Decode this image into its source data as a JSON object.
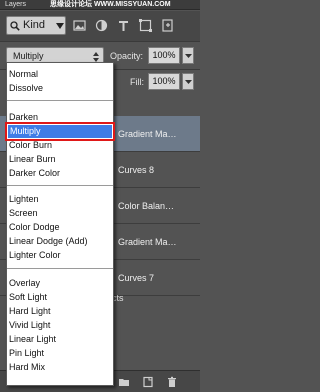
{
  "panel": {
    "title": "Layers",
    "watermark": "思缘设计论坛 WWW.MISSYUAN.COM"
  },
  "filter": {
    "kind_label": "Kind",
    "icons": [
      "image-filter-icon",
      "adjustment-filter-icon",
      "type-filter-icon",
      "shape-filter-icon",
      "smart-object-filter-icon"
    ]
  },
  "blend": {
    "current": "Multiply",
    "opacity_label": "Opacity:",
    "opacity_value": "100%",
    "fill_label": "Fill:",
    "fill_value": "100%"
  },
  "dropdown": {
    "groups": [
      [
        "Normal",
        "Dissolve"
      ],
      [
        "Darken",
        "Multiply",
        "Color Burn",
        "Linear Burn",
        "Darker Color"
      ],
      [
        "Lighten",
        "Screen",
        "Color Dodge",
        "Linear Dodge (Add)",
        "Lighter Color"
      ],
      [
        "Overlay",
        "Soft Light",
        "Hard Light",
        "Vivid Light",
        "Linear Light",
        "Pin Light",
        "Hard Mix"
      ]
    ],
    "selected": "Multiply"
  },
  "layers": [
    {
      "name": "Gradient Ma…",
      "selected": true
    },
    {
      "name": "Curves 8",
      "selected": false
    },
    {
      "name": "Color Balan…",
      "selected": false
    },
    {
      "name": "Gradient Ma…",
      "selected": false
    },
    {
      "name": "Curves 7",
      "selected": false
    }
  ],
  "layers_extra": {
    "effects_label": "cts"
  },
  "colors": {
    "panel_bg": "#535353",
    "selection_blue": "#3f7ce6",
    "highlight_red": "#e01818"
  }
}
